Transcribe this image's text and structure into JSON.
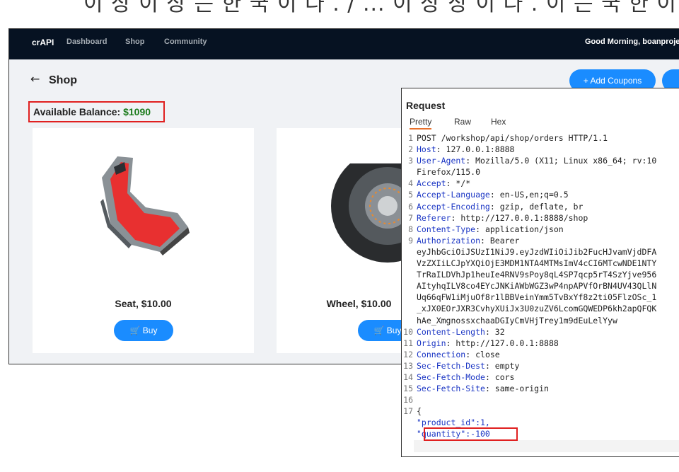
{
  "caption": "이 상 이 상 는 한 국 이 다 . / ... 이 상 상 이 다 . 이 는 국 한 이 는 것 은 이",
  "nav": {
    "brand": "crAPI",
    "links": [
      "Dashboard",
      "Shop",
      "Community"
    ],
    "greeting": "Good Morning, boanproject"
  },
  "page": {
    "back_icon": "←",
    "title": "Shop",
    "balance_label": "Available Balance:",
    "balance_value": "$1090",
    "add_coupons": "+ Add Coupons"
  },
  "products": [
    {
      "title": "Seat, $10.00",
      "buy": "🛒 Buy"
    },
    {
      "title": "Wheel, $10.00",
      "buy": "🛒 Buy"
    }
  ],
  "request": {
    "title": "Request",
    "tabs": [
      "Pretty",
      "Raw",
      "Hex"
    ],
    "lines": [
      {
        "n": "1",
        "k": "",
        "v": "POST /workshop/api/shop/orders HTTP/1.1"
      },
      {
        "n": "2",
        "k": "Host",
        "v": ": 127.0.0.1:8888"
      },
      {
        "n": "3",
        "k": "User-Agent",
        "v": ": Mozilla/5.0 (X11; Linux x86_64; rv:10"
      },
      {
        "n": "",
        "k": "",
        "v": "Firefox/115.0"
      },
      {
        "n": "4",
        "k": "Accept",
        "v": ": */*"
      },
      {
        "n": "5",
        "k": "Accept-Language",
        "v": ": en-US,en;q=0.5"
      },
      {
        "n": "6",
        "k": "Accept-Encoding",
        "v": ": gzip, deflate, br"
      },
      {
        "n": "7",
        "k": "Referer",
        "v": ": http://127.0.0.1:8888/shop"
      },
      {
        "n": "8",
        "k": "Content-Type",
        "v": ": application/json"
      },
      {
        "n": "9",
        "k": "Authorization",
        "v": ": Bearer"
      },
      {
        "n": "",
        "k": "",
        "v": "eyJhbGciOiJSUzI1NiJ9.eyJzdWIiOiJib2FucHJvamVjdDFA"
      },
      {
        "n": "",
        "k": "",
        "v": "VzZXIiLCJpYXQiOjE3MDM1NTA4MTMsImV4cCI6MTcwNDE1NTY"
      },
      {
        "n": "",
        "k": "",
        "v": "TrRaILDVhJp1heuIe4RNV9sPoy8qL4SP7qcp5rT4SzYjve956"
      },
      {
        "n": "",
        "k": "",
        "v": "AItyhqILV8co4EYcJNKiAWbWGZ3wP4npAPVfOrBN4UV43QLlN"
      },
      {
        "n": "",
        "k": "",
        "v": "Uq66qFW1iMjuOf8r1lBBVeinYmm5TvBxYf8z2ti05FlzOSc_1"
      },
      {
        "n": "",
        "k": "",
        "v": "_xJX0EOrJXR3CvhyXUiJx3U0zuZV6LcomGQWEDP6kh2apQFQK"
      },
      {
        "n": "",
        "k": "",
        "v": "hAe_XmgnossxchaaDGIyCmVHjTrey1m9dEuLelYyw"
      },
      {
        "n": "10",
        "k": "Content-Length",
        "v": ": 32"
      },
      {
        "n": "11",
        "k": "Origin",
        "v": ": http://127.0.0.1:8888"
      },
      {
        "n": "12",
        "k": "Connection",
        "v": ": close"
      },
      {
        "n": "13",
        "k": "Sec-Fetch-Dest",
        "v": ": empty"
      },
      {
        "n": "14",
        "k": "Sec-Fetch-Mode",
        "v": ": cors"
      },
      {
        "n": "15",
        "k": "Sec-Fetch-Site",
        "v": ": same-origin"
      },
      {
        "n": "16",
        "k": "",
        "v": ""
      },
      {
        "n": "17",
        "k": "",
        "v": "{"
      },
      {
        "n": "",
        "k": "",
        "v": "  \"product_id\":1,"
      },
      {
        "n": "",
        "k": "",
        "v": "  \"quantity\":-100"
      },
      {
        "n": "",
        "k": "",
        "v": "}"
      }
    ]
  },
  "colors": {
    "navbar": "#061222",
    "primary_button": "#1a8cff",
    "highlight_box": "#e02020",
    "balance_value": "#1a7a1a",
    "header_key": "#1a35c4"
  }
}
